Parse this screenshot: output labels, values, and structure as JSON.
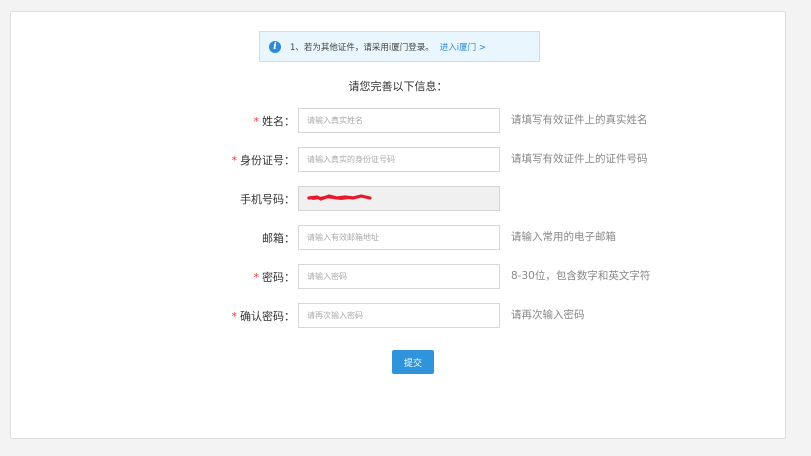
{
  "notice": {
    "text": "1、若为其他证件，请采用i厦门登录。",
    "link": "进入i厦门 >"
  },
  "heading": "请您完善以下信息：",
  "fields": [
    {
      "required": "*",
      "label": "姓名：",
      "placeholder": "请输入真实姓名",
      "hint": "请填写有效证件上的真实姓名"
    },
    {
      "required": "*",
      "label": "身份证号：",
      "placeholder": "请输入真实的身份证号码",
      "hint": "请填写有效证件上的证件号码"
    },
    {
      "required": "",
      "label": "手机号码：",
      "value": "",
      "hint": ""
    },
    {
      "required": "",
      "label": "邮箱：",
      "placeholder": "请输入有效邮箱地址",
      "hint": "请输入常用的电子邮箱"
    },
    {
      "required": "*",
      "label": "密码：",
      "placeholder": "请输入密码",
      "hint": "8-30位，包含数字和英文字符"
    },
    {
      "required": "*",
      "label": "确认密码：",
      "placeholder": "请再次输入密码",
      "hint": "请再次输入密码"
    }
  ],
  "submit_label": "提交",
  "colors": {
    "accent": "#2f94dc",
    "required": "#e53935",
    "redaction": "#e8192c"
  },
  "icons": {
    "notice": "info-icon",
    "phone_value": "redacted-scribble"
  }
}
